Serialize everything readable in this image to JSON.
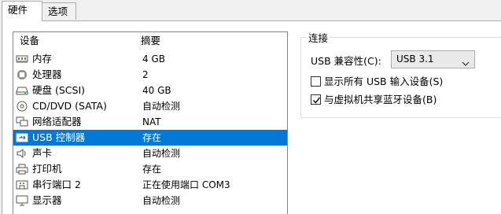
{
  "tabs": [
    {
      "label": "硬件"
    },
    {
      "label": "选项"
    }
  ],
  "device_list": {
    "columns": {
      "device": "设备",
      "summary": "摘要"
    },
    "rows": [
      {
        "icon": "memory-icon",
        "name": "内存",
        "summary": "4 GB"
      },
      {
        "icon": "processor-icon",
        "name": "处理器",
        "summary": "2"
      },
      {
        "icon": "hard-disk-icon",
        "name": "硬盘 (SCSI)",
        "summary": "40 GB"
      },
      {
        "icon": "cd-dvd-icon",
        "name": "CD/DVD (SATA)",
        "summary": "自动检测"
      },
      {
        "icon": "network-adapter-icon",
        "name": "网络适配器",
        "summary": "NAT"
      },
      {
        "icon": "usb-icon",
        "name": "USB 控制器",
        "summary": "存在"
      },
      {
        "icon": "sound-card-icon",
        "name": "声卡",
        "summary": "自动检测"
      },
      {
        "icon": "printer-icon",
        "name": "打印机",
        "summary": "存在"
      },
      {
        "icon": "serial-port-icon",
        "name": "串行端口 2",
        "summary": "正在使用端口 COM3"
      },
      {
        "icon": "display-icon",
        "name": "显示器",
        "summary": "自动检测"
      }
    ],
    "selected_index": 5
  },
  "connection": {
    "title": "连接",
    "compat_label": "USB 兼容性(C):",
    "compat_value": "USB 3.1",
    "show_all_label": "显示所有 USB 输入设备(S)",
    "show_all_checked": false,
    "share_bt_label": "与虚拟机共享蓝牙设备(B)",
    "share_bt_checked": true
  },
  "colors": {
    "selection": "#0078d7",
    "border": "#adadad"
  }
}
